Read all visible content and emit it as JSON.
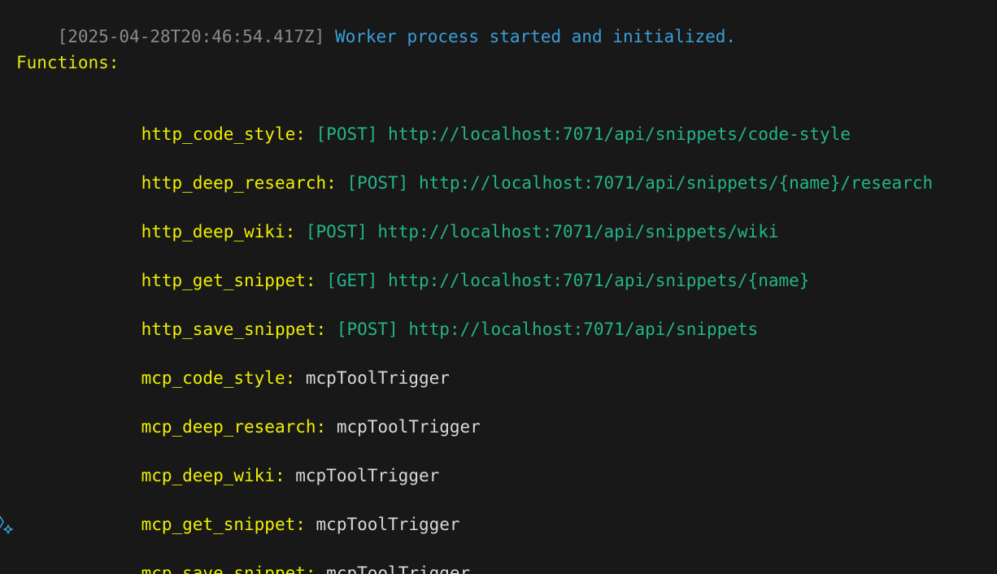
{
  "log": {
    "timestamp": "[2025-04-28T20:46:54.417Z]",
    "message": "Worker process started and initialized."
  },
  "functions_header": "Functions:",
  "http_functions": [
    {
      "name": "http_code_style:",
      "method": "[POST]",
      "url": "http://localhost:7071/api/snippets/code-style"
    },
    {
      "name": "http_deep_research:",
      "method": "[POST]",
      "url": "http://localhost:7071/api/snippets/{name}/research"
    },
    {
      "name": "http_deep_wiki:",
      "method": "[POST]",
      "url": "http://localhost:7071/api/snippets/wiki"
    },
    {
      "name": "http_get_snippet:",
      "method": "[GET]",
      "url": "http://localhost:7071/api/snippets/{name}"
    },
    {
      "name": "http_save_snippet:",
      "method": "[POST]",
      "url": "http://localhost:7071/api/snippets"
    }
  ],
  "mcp_functions": [
    {
      "name": "mcp_code_style:",
      "trigger": "mcpToolTrigger"
    },
    {
      "name": "mcp_deep_research:",
      "trigger": "mcpToolTrigger"
    },
    {
      "name": "mcp_deep_wiki:",
      "trigger": "mcpToolTrigger"
    },
    {
      "name": "mcp_get_snippet:",
      "trigger": "mcpToolTrigger"
    },
    {
      "name": "mcp_save_snippet:",
      "trigger": "mcpToolTrigger"
    }
  ],
  "gutter_icon": "sparkle-icon",
  "colors": {
    "background": "#181818",
    "timestamp": "#8b8b8b",
    "message": "#3b9fdb",
    "function_name": "#f0f000",
    "http_info": "#23b58a",
    "trigger": "#d8d8d8"
  }
}
